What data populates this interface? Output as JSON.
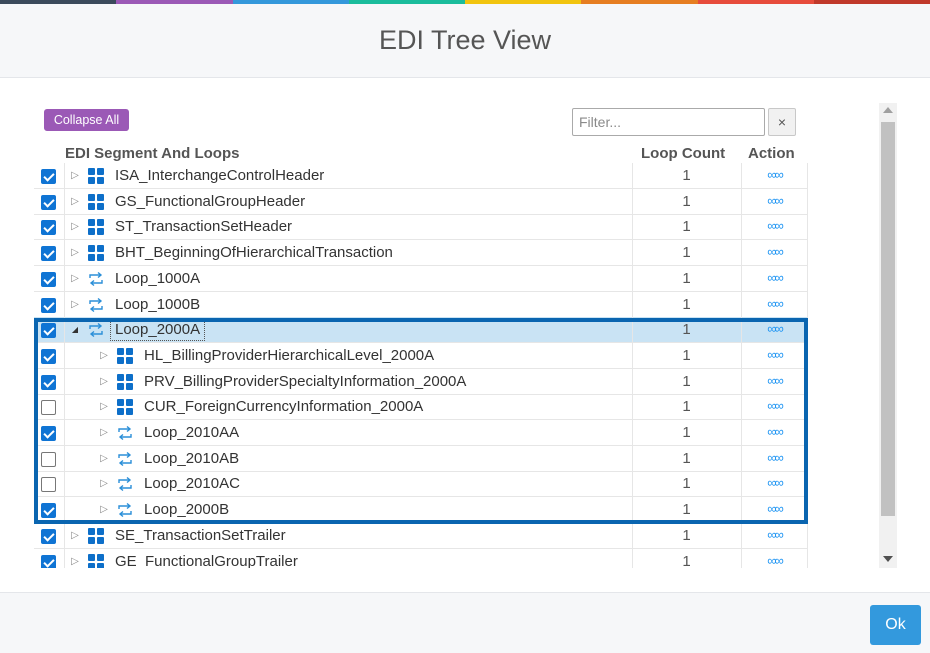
{
  "dialog": {
    "title": "EDI Tree View",
    "ok_label": "Ok",
    "stripe_colors": [
      "#3b4a5c",
      "#9b59b6",
      "#3498db",
      "#1abc9c",
      "#f1c40f",
      "#e67e22",
      "#e74c3c",
      "#c0392b"
    ]
  },
  "toolbar": {
    "collapse_all_label": "Collapse All",
    "filter_placeholder": "Filter...",
    "filter_clear_label": "×"
  },
  "grid": {
    "columns": {
      "segment": "EDI Segment And Loops",
      "loop_count": "Loop Count",
      "action": "Action"
    },
    "action_icon": "link-icon",
    "action_glyph": "∞∞",
    "rows": [
      {
        "label": "ISA_InterchangeControlHeader",
        "type": "segment",
        "level": 0,
        "checked": true,
        "expanded": false,
        "count": "1"
      },
      {
        "label": "GS_FunctionalGroupHeader",
        "type": "segment",
        "level": 0,
        "checked": true,
        "expanded": false,
        "count": "1"
      },
      {
        "label": "ST_TransactionSetHeader",
        "type": "segment",
        "level": 0,
        "checked": true,
        "expanded": false,
        "count": "1"
      },
      {
        "label": "BHT_BeginningOfHierarchicalTransaction",
        "type": "segment",
        "level": 0,
        "checked": true,
        "expanded": false,
        "count": "1"
      },
      {
        "label": "Loop_1000A",
        "type": "loop",
        "level": 0,
        "checked": true,
        "expanded": false,
        "count": "1"
      },
      {
        "label": "Loop_1000B",
        "type": "loop",
        "level": 0,
        "checked": true,
        "expanded": false,
        "count": "1"
      },
      {
        "label": "Loop_2000A",
        "type": "loop",
        "level": 0,
        "checked": true,
        "expanded": true,
        "selected": true,
        "count": "1"
      },
      {
        "label": "HL_BillingProviderHierarchicalLevel_2000A",
        "type": "segment",
        "level": 1,
        "checked": true,
        "expanded": false,
        "count": "1"
      },
      {
        "label": "PRV_BillingProviderSpecialtyInformation_2000A",
        "type": "segment",
        "level": 1,
        "checked": true,
        "expanded": false,
        "count": "1"
      },
      {
        "label": "CUR_ForeignCurrencyInformation_2000A",
        "type": "segment",
        "level": 1,
        "checked": false,
        "expanded": false,
        "count": "1"
      },
      {
        "label": "Loop_2010AA",
        "type": "loop",
        "level": 1,
        "checked": true,
        "expanded": false,
        "count": "1"
      },
      {
        "label": "Loop_2010AB",
        "type": "loop",
        "level": 1,
        "checked": false,
        "expanded": false,
        "count": "1"
      },
      {
        "label": "Loop_2010AC",
        "type": "loop",
        "level": 1,
        "checked": false,
        "expanded": false,
        "count": "1"
      },
      {
        "label": "Loop_2000B",
        "type": "loop",
        "level": 1,
        "checked": true,
        "expanded": false,
        "count": "1"
      },
      {
        "label": "SE_TransactionSetTrailer",
        "type": "segment",
        "level": 0,
        "checked": true,
        "expanded": false,
        "count": "1"
      },
      {
        "label": "GE_FunctionalGroupTrailer",
        "type": "segment",
        "level": 0,
        "checked": true,
        "expanded": false,
        "count": "1"
      }
    ]
  },
  "colors": {
    "accent_blue": "#0f74d4",
    "highlight_border": "#0a65b0",
    "selected_row": "#c9e3f4",
    "collapse_button": "#9b59b6",
    "ok_button": "#3399dd"
  }
}
